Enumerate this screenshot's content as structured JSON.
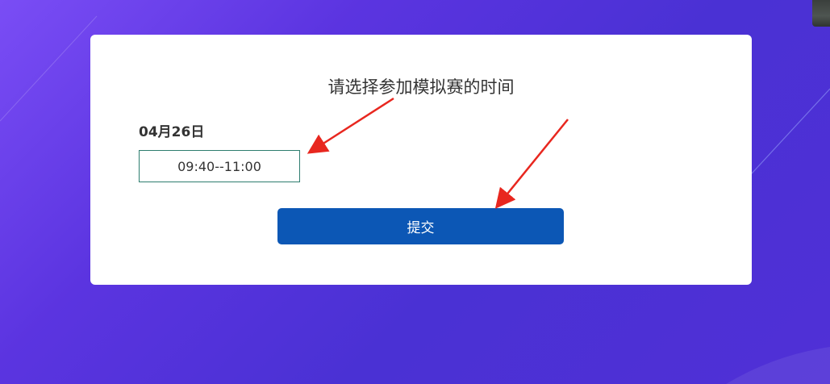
{
  "dialog": {
    "title": "请选择参加模拟赛的时间",
    "date_label": "04月26日",
    "time_slot": "09:40--11:00",
    "submit_label": "提交"
  },
  "colors": {
    "background_start": "#7a4df5",
    "background_end": "#4a31d4",
    "submit_button": "#0c57b5",
    "time_slot_border": "#2e7d6f",
    "annotation_arrow": "#e8271f"
  },
  "annotations": [
    {
      "name": "arrow-to-time-slot"
    },
    {
      "name": "arrow-to-submit"
    }
  ]
}
